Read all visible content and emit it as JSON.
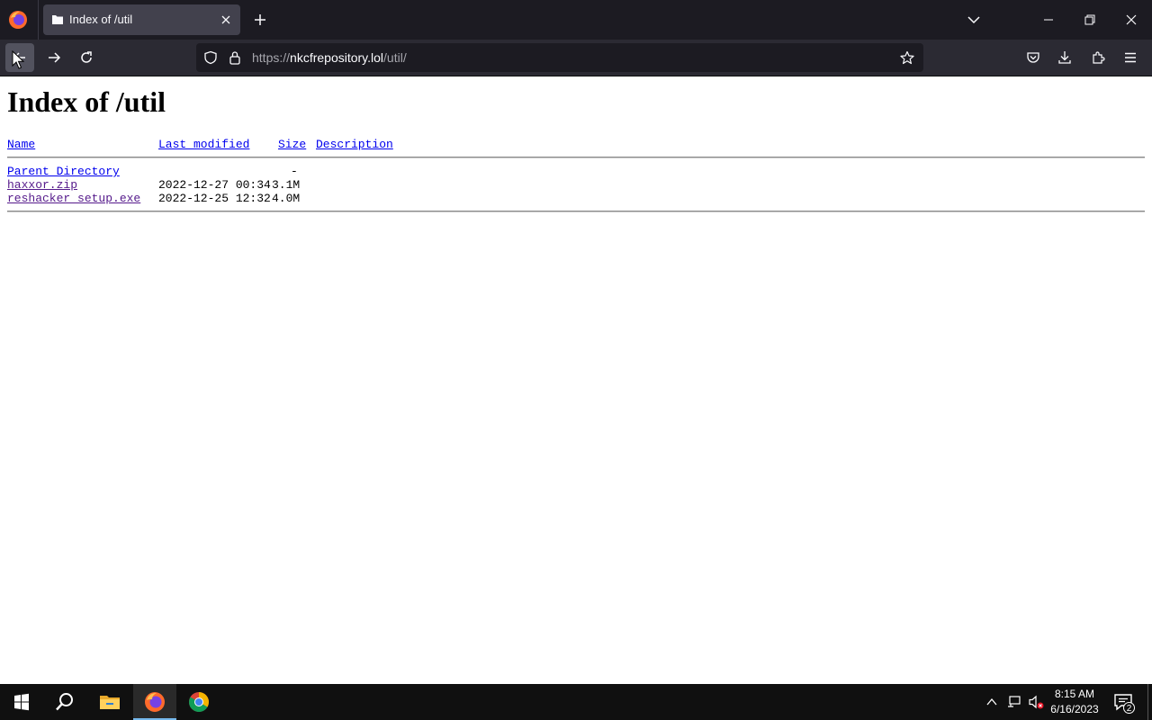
{
  "browser": {
    "tab": {
      "title": "Index of /util"
    },
    "url": {
      "prefix": "https://",
      "domain": "nkcfrepository.lol",
      "path": "/util/"
    }
  },
  "page": {
    "title": "Index of /util",
    "columns": {
      "name": "Name",
      "last_modified": "Last modified",
      "size": "Size",
      "description": "Description"
    },
    "rows": [
      {
        "name": "Parent Directory",
        "last_modified": "",
        "size": "-",
        "description": ""
      },
      {
        "name": "haxxor.zip",
        "last_modified": "2022-12-27 00:34",
        "size": "3.1M",
        "description": ""
      },
      {
        "name": "reshacker_setup.exe",
        "last_modified": "2022-12-25 12:32",
        "size": "4.0M",
        "description": ""
      }
    ]
  },
  "taskbar": {
    "clock_time": "8:15 AM",
    "clock_date": "6/16/2023",
    "notification_count": "2"
  },
  "colors": {
    "link": "#0000ee",
    "visited_link": "#551a8b",
    "tab_bar": "#1c1b22",
    "toolbar": "#2b2a33",
    "taskbar": "#101010"
  }
}
